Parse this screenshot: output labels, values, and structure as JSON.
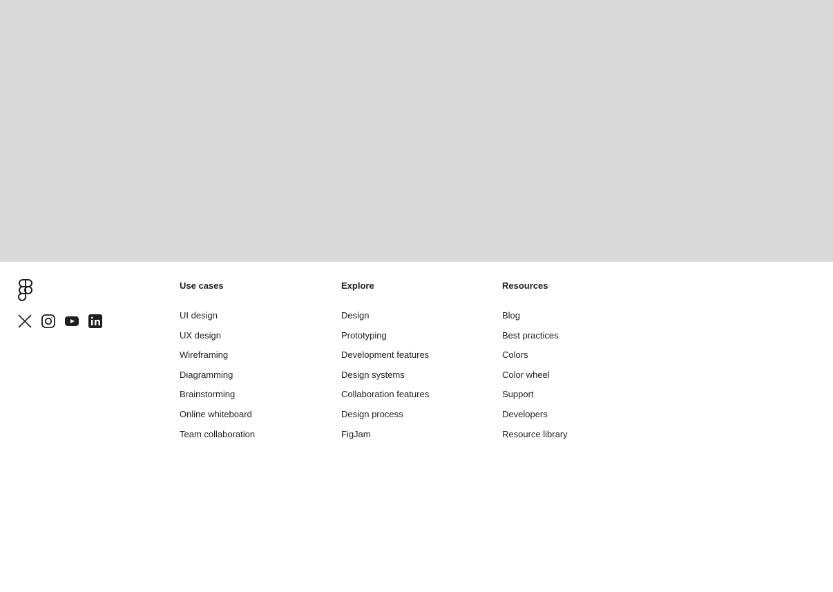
{
  "hero": {},
  "footer": {
    "logo": "figma-logo",
    "socials": [
      {
        "icon": "x-twitter-icon"
      },
      {
        "icon": "instagram-icon"
      },
      {
        "icon": "youtube-icon"
      },
      {
        "icon": "linkedin-icon"
      }
    ],
    "columns": [
      {
        "heading": "Use cases",
        "links": [
          "UI design",
          "UX design",
          "Wireframing",
          "Diagramming",
          "Brainstorming",
          "Online whiteboard",
          "Team collaboration"
        ]
      },
      {
        "heading": "Explore",
        "links": [
          "Design",
          "Prototyping",
          "Development features",
          "Design systems",
          "Collaboration features",
          "Design process",
          "FigJam"
        ]
      },
      {
        "heading": "Resources",
        "links": [
          "Blog",
          "Best practices",
          "Colors",
          "Color wheel",
          "Support",
          "Developers",
          "Resource library"
        ]
      }
    ]
  },
  "colors": {
    "placeholder": "#d9d9d9",
    "text": "#1e1e1e",
    "background": "#ffffff"
  }
}
